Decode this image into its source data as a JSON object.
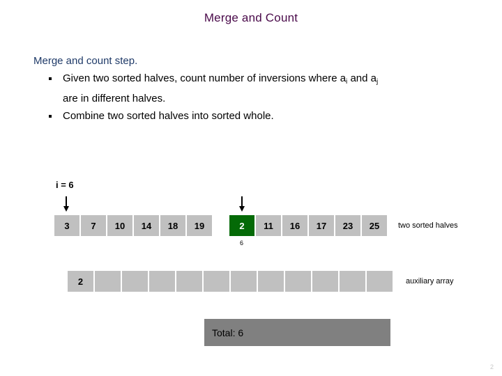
{
  "slide": {
    "title": "Merge and Count",
    "page_number": "2",
    "title_color": "#4a0a4a"
  },
  "body": {
    "step_heading": "Merge and count step.",
    "step_heading_color": "#1f3a68",
    "bullets": [
      {
        "text_before": "Given two sorted halves, count number of inversions where a",
        "sub1": "i",
        "text_mid": " and a",
        "sub2": "j",
        "text_after": "",
        "line2": "are in different halves."
      },
      {
        "text_before": "Combine two sorted halves into sorted whole.",
        "sub1": "",
        "text_mid": "",
        "sub2": "",
        "text_after": "",
        "line2": ""
      }
    ]
  },
  "pointers": {
    "i_label": "i = 6",
    "j_label": ""
  },
  "arrays": {
    "left_half": {
      "values": [
        "3",
        "7",
        "10",
        "14",
        "18",
        "19"
      ],
      "highlight_index": -1
    },
    "right_half": {
      "values": [
        "2",
        "11",
        "16",
        "17",
        "23",
        "25"
      ],
      "highlight_index": 0,
      "highlight_color": "#046a07",
      "count_below": "6"
    },
    "halves_label": "two sorted halves",
    "auxiliary": {
      "values": [
        "2",
        "",
        "",
        "",
        "",
        "",
        "",
        "",
        "",
        "",
        "",
        ""
      ],
      "label": "auxiliary array"
    },
    "cell_color": "#c0c0c0"
  },
  "total": {
    "text": "Total:  6",
    "bar_color": "#808080"
  }
}
